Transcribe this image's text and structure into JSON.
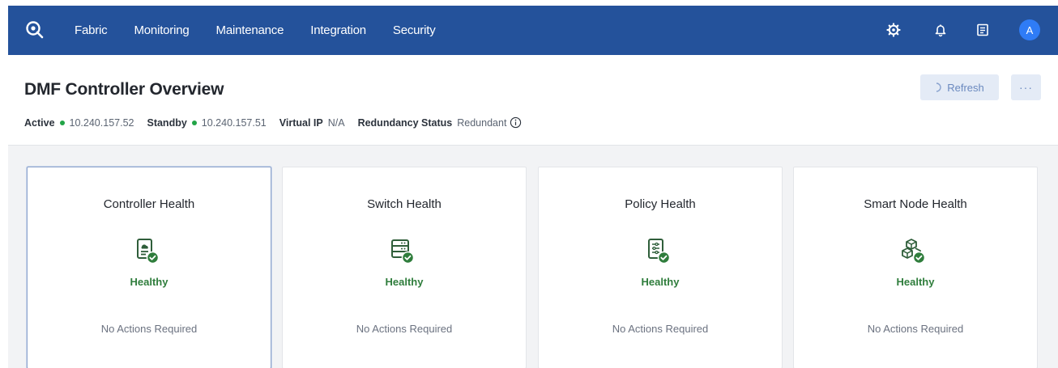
{
  "nav": {
    "items": [
      "Fabric",
      "Monitoring",
      "Maintenance",
      "Integration",
      "Security"
    ],
    "icons": [
      "settings-icon",
      "bell-icon",
      "tasks-icon"
    ],
    "avatar": "A",
    "brand_color": "#24529b"
  },
  "header": {
    "title": "DMF Controller Overview",
    "active_label": "Active",
    "active_ip": "10.240.157.52",
    "standby_label": "Standby",
    "standby_ip": "10.240.157.51",
    "vip_label": "Virtual IP",
    "vip_value": "N/A",
    "redundancy_label": "Redundancy Status",
    "redundancy_value": "Redundant",
    "refresh_label": "Refresh",
    "more_label": "···"
  },
  "cards": [
    {
      "title": "Controller Health",
      "status": "Healthy",
      "action": "No Actions Required",
      "icon": "controller-icon"
    },
    {
      "title": "Switch Health",
      "status": "Healthy",
      "action": "No Actions Required",
      "icon": "switch-icon"
    },
    {
      "title": "Policy Health",
      "status": "Healthy",
      "action": "No Actions Required",
      "icon": "policy-icon"
    },
    {
      "title": "Smart Node Health",
      "status": "Healthy",
      "action": "No Actions Required",
      "icon": "smart-node-icon"
    }
  ],
  "colors": {
    "healthy": "#2f7d3c",
    "status_dot": "#22a447"
  }
}
